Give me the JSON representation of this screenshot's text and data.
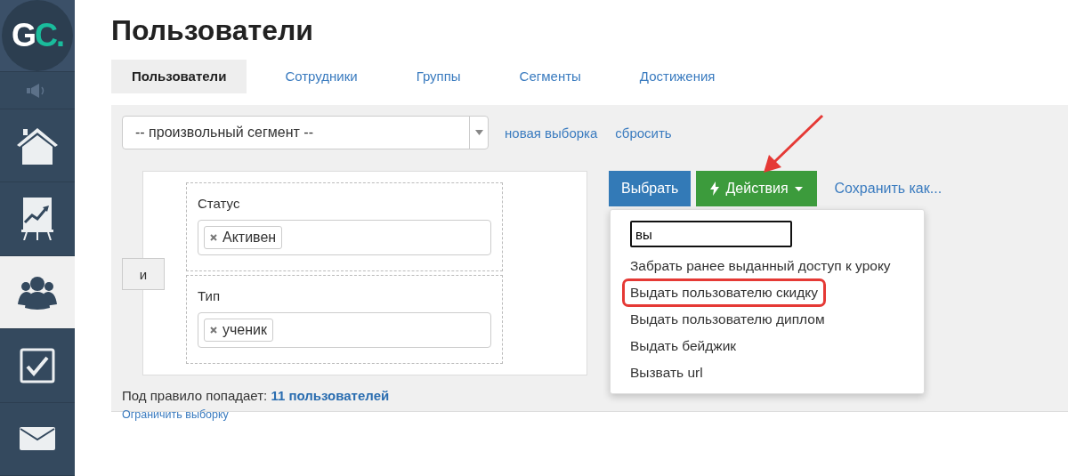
{
  "logo": {
    "first": "G",
    "second": "C."
  },
  "sidebar": {
    "items": [
      {
        "kind": "sound",
        "selected": false
      },
      {
        "kind": "home",
        "selected": false
      },
      {
        "kind": "chart",
        "selected": false
      },
      {
        "kind": "users",
        "selected": true
      },
      {
        "kind": "check",
        "selected": false
      },
      {
        "kind": "mail",
        "selected": false
      }
    ]
  },
  "title": "Пользователи",
  "tabs": [
    {
      "label": "Пользователи",
      "selected": true
    },
    {
      "label": "Сотрудники",
      "selected": false
    },
    {
      "label": "Группы",
      "selected": false
    },
    {
      "label": "Сегменты",
      "selected": false
    },
    {
      "label": "Достижения",
      "selected": false
    }
  ],
  "segment_select": {
    "value": "-- произвольный сегмент --"
  },
  "links": [
    "новая выборка",
    "сбросить"
  ],
  "rule": {
    "operator": "и",
    "conditions": [
      {
        "label": "Статус",
        "tags": [
          "Активен"
        ]
      },
      {
        "label": "Тип",
        "tags": [
          "ученик"
        ]
      }
    ]
  },
  "summary": {
    "text": "Под правило попадает: **11 пользователей**",
    "limit_link": "Ограничить выборку"
  },
  "buttons": {
    "select": "Выбрать",
    "actions": "Действия",
    "save": "Сохранить как..."
  },
  "actions_menu": {
    "search_value": "вы",
    "items": [
      {
        "label": "Забрать ранее выданный доступ к уроку",
        "highlighted": false
      },
      {
        "label": "Выдать пользователю скидку",
        "highlighted": true
      },
      {
        "label": "Выдать пользователю диплом",
        "highlighted": false
      },
      {
        "label": "Выдать бейджик",
        "highlighted": false
      },
      {
        "label": "Вызвать url",
        "highlighted": false
      }
    ]
  }
}
